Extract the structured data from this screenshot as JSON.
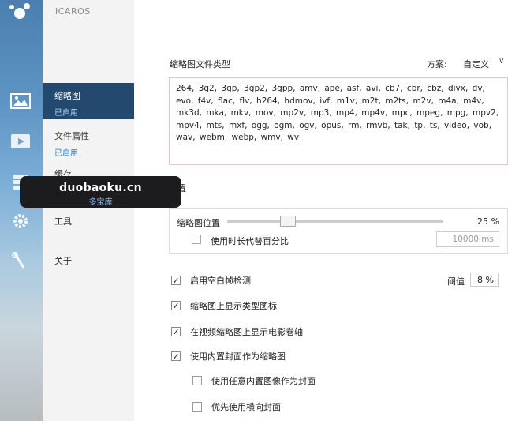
{
  "app": {
    "title": "ICAROS"
  },
  "rail": {
    "icons": [
      "app-logo",
      "image-icon",
      "video-icon",
      "storage-icon",
      "gear-icon",
      "wrench-icon"
    ]
  },
  "nav": {
    "items": [
      {
        "label": "缩略图",
        "status": "已启用"
      },
      {
        "label": "文件属性",
        "status": "已启用"
      },
      {
        "label": "缓存"
      },
      {
        "label": "工具"
      },
      {
        "label": "关于"
      }
    ]
  },
  "thumbnails": {
    "types_label": "缩略图文件类型",
    "scheme_label": "方案:",
    "scheme_value": "自定义",
    "file_types": "264, 3g2, 3gp, 3gp2, 3gpp, amv, ape, asf, avi, cb7, cbr, cbz, divx, dv, evo, f4v, flac, flv, h264, hdmov, ivf, m1v, m2t, m2ts, m2v, m4a, m4v, mk3d, mka, mkv, mov, mp2v, mp3, mp4, mp4v, mpc, mpeg, mpg, mpv2, mpv4, mts, mxf, ogg, ogm, ogv, opus, rm, rmvb, tak, tp, ts, video, vob, wav, webm, webp, wmv, wv",
    "position_section_label": "位置",
    "position_label": "缩略图位置",
    "position_value": "25 %",
    "position_fraction": 0.25,
    "duration_check_label": "使用时长代替百分比",
    "duration_checked": false,
    "duration_value": "10000 ms",
    "options": [
      {
        "label": "启用空白帧检测",
        "checked": true
      },
      {
        "label": "缩略图上显示类型图标",
        "checked": true
      },
      {
        "label": "在视频缩略图上显示电影卷轴",
        "checked": true
      },
      {
        "label": "使用内置封面作为缩略图",
        "checked": true
      },
      {
        "label": "使用任意内置图像作为封面",
        "checked": false
      },
      {
        "label": "优先使用横向封面",
        "checked": false
      }
    ],
    "threshold_label": "阈值",
    "threshold_value": "8 %"
  },
  "watermark": {
    "title": "duobaoku.cn",
    "subtitle": "多宝库"
  },
  "colors": {
    "nav_active": "#23496f",
    "status_blue": "#2a7fd0",
    "types_border": "#e6c7cf"
  }
}
